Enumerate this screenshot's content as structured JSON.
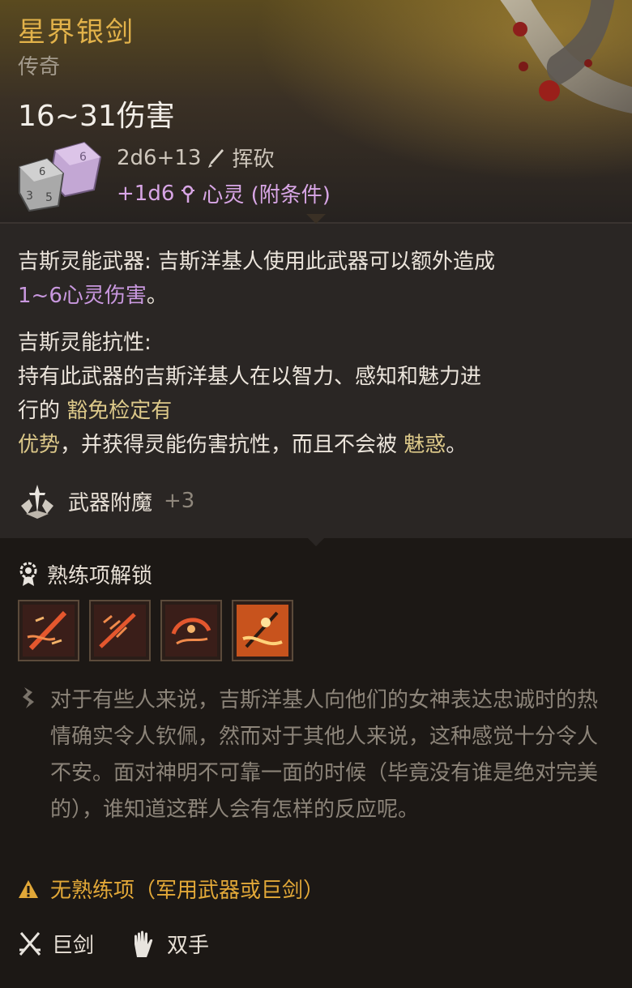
{
  "item": {
    "name": "星界银剑",
    "rarity": "传奇",
    "damage": "16~31伤害",
    "roll_primary_dice": "2d6+13",
    "roll_primary_type": "挥砍",
    "roll_bonus_dice": "+1d6",
    "roll_bonus_type": "心灵 (附条件)"
  },
  "passives": {
    "p1_title": "吉斯灵能武器:",
    "p1_text": " 吉斯洋基人使用此武器可以额外造成",
    "p1_highlight": "1~6心灵伤害",
    "p1_end": "。",
    "p2_title": "吉斯灵能抗性:",
    "p2_line1": "持有此武器的吉斯洋基人在以智力、感知和魅力进",
    "p2_line2_pre": "行的 ",
    "p2_line2_gold": "豁免检定有",
    "p2_line3_gold": "优势",
    "p2_line3_mid": "，并获得灵能伤害抗性，而且不会被 ",
    "p2_line3_gold2": "魅惑",
    "p2_line3_end": "。"
  },
  "enchant": {
    "label": "武器附魔",
    "value": "+3"
  },
  "proficiency": {
    "title": "熟练项解锁",
    "actions": [
      {
        "icon": "slash-action-icon"
      },
      {
        "icon": "lacerate-action-icon"
      },
      {
        "icon": "cleave-action-icon"
      },
      {
        "icon": "rush-attack-action-icon"
      }
    ]
  },
  "flavor": "对于有些人来说，吉斯洋基人向他们的女神表达忠诚时的热情确实令人钦佩，然而对于其他人来说，这种感觉十分令人不安。面对神明不可靠一面的时候（毕竟没有谁是绝对完美的），谁知道这群人会有怎样的反应呢。",
  "warning": "无熟练项（军用武器或巨剑）",
  "tags": {
    "type": "巨剑",
    "handedness": "双手"
  },
  "colors": {
    "gold": "#e2b24a",
    "psychic": "#c998df",
    "warning": "#e2a838"
  }
}
